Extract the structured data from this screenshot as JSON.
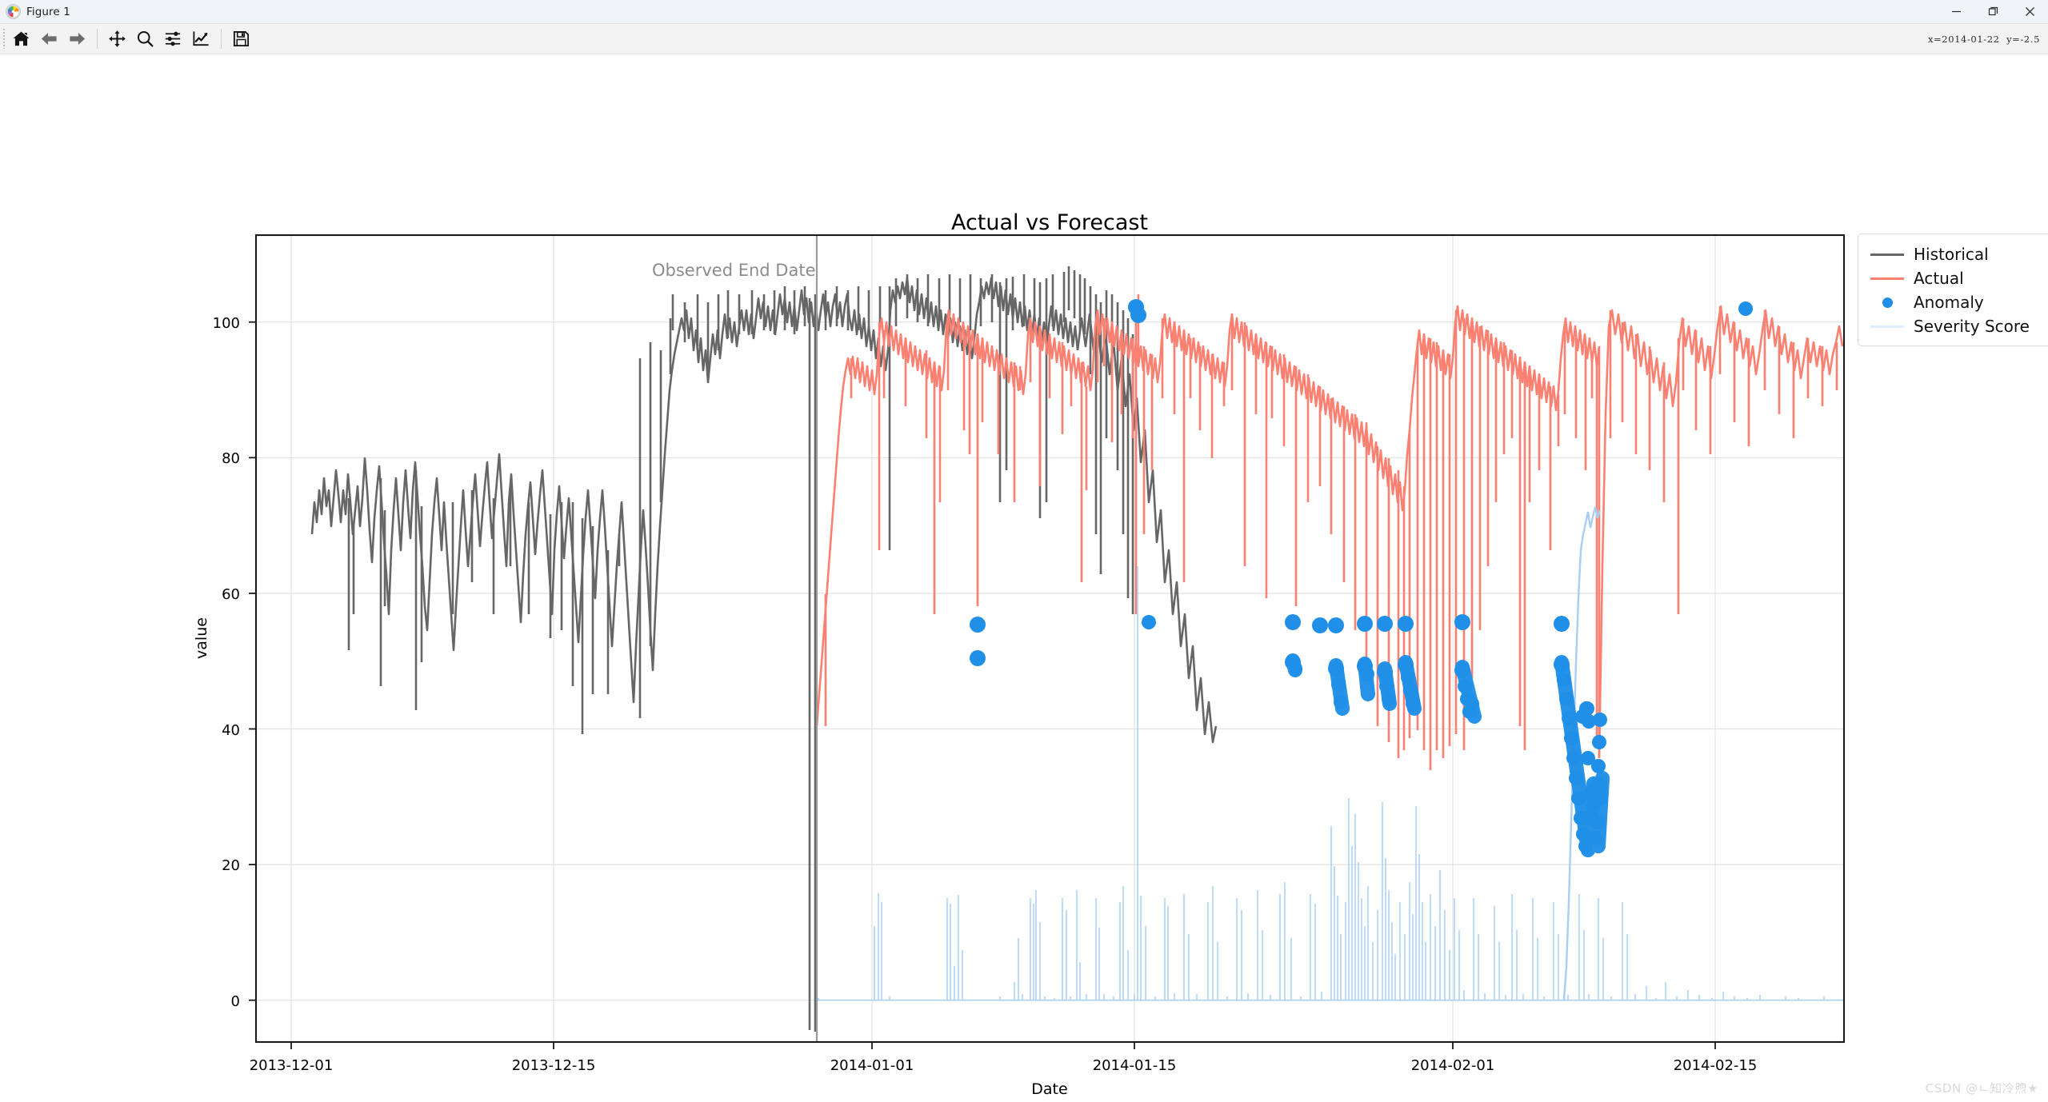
{
  "window": {
    "title": "Figure 1",
    "icon": "matplotlib-icon",
    "minimize_label": "—",
    "maximize_label": "□",
    "close_label": "✕"
  },
  "toolbar": {
    "buttons": [
      {
        "name": "home-icon",
        "tooltip": "Reset original view"
      },
      {
        "name": "back-arrow-icon",
        "tooltip": "Back to previous view"
      },
      {
        "name": "forward-arrow-icon",
        "tooltip": "Forward to next view"
      },
      {
        "name": "pan-move-icon",
        "tooltip": "Pan axes with left mouse, zoom with right"
      },
      {
        "name": "zoom-magnifier-icon",
        "tooltip": "Zoom to rectangle"
      },
      {
        "name": "subplot-config-sliders-icon",
        "tooltip": "Configure subplots"
      },
      {
        "name": "edit-curve-chart-icon",
        "tooltip": "Edit axis, curve and image parameters"
      },
      {
        "name": "save-floppy-icon",
        "tooltip": "Save the figure"
      }
    ],
    "coordinate_readout": "x=2014-01-22  y=-2.5"
  },
  "watermark": "CSDN @ㄴ知冷煦★",
  "legend": {
    "items": [
      {
        "label": "Historical",
        "marker": "line",
        "color": "#666666"
      },
      {
        "label": "Actual",
        "marker": "line",
        "color": "#fa8072"
      },
      {
        "label": "Anomaly",
        "marker": "dot",
        "color": "#1f8fe8"
      },
      {
        "label": "Severity Score",
        "marker": "line",
        "color": "#ddeeff"
      }
    ]
  },
  "annotations": [
    {
      "name": "observed-end-date-label",
      "text": "Observed End Date",
      "x": "2013-12-29",
      "color": "#8c8c8c"
    }
  ],
  "chart_data": {
    "type": "line",
    "title": "Actual vs Forecast",
    "xlabel": "Date",
    "ylabel": "value",
    "grid": true,
    "legend_position": "upper right outside",
    "xlim": [
      "2013-11-30",
      "2014-02-21"
    ],
    "ylim": [
      -6,
      113
    ],
    "yticks": [
      0,
      20,
      40,
      60,
      80,
      100
    ],
    "ytick_labels": [
      "0",
      "20",
      "40",
      "60",
      "80",
      "100"
    ],
    "xticks": [
      "2013-12-01",
      "2013-12-15",
      "2014-01-01",
      "2014-01-15",
      "2014-02-01",
      "2014-02-15"
    ],
    "xtick_labels": [
      "2013-12-01",
      "2013-12-15",
      "2014-01-01",
      "2014-01-15",
      "2014-02-01",
      "2014-02-15"
    ],
    "vline": {
      "label": "Observed End Date",
      "x": "2013-12-29",
      "color": "#9a9a9a"
    },
    "series": [
      {
        "name": "Historical",
        "color": "#666666",
        "type": "line",
        "x_range": [
          "2013-12-01",
          "2013-12-29"
        ],
        "y_range": [
          2.2,
          104.5
        ],
        "description": "Dense gray noisy signal oscillating mostly between 78 and 104 with sharp downward spikes to 48-68 and one extreme drop to ~2"
      },
      {
        "name": "Actual",
        "color": "#fa8072",
        "type": "line",
        "x_range": [
          "2013-12-29",
          "2014-02-20"
        ],
        "y_range": [
          46.0,
          105.0
        ],
        "description": "Dense salmon signal mostly 86-103 with frequent sharp dips to 58-75 and a deep cluster of drops to 46-58 around 2014-01-28 to 2014-02-09"
      },
      {
        "name": "Severity Score",
        "color": "#cce2fb",
        "type": "line",
        "x_range": [
          "2013-12-29",
          "2014-02-20"
        ],
        "y_range": [
          0.0,
          75.0
        ],
        "description": "Very light blue spiky score near 0 baseline with narrow spikes to 15-48 and a sustained rise to ~75 around 2014-02-09"
      },
      {
        "name": "Anomaly",
        "color": "#1f8fe8",
        "type": "scatter",
        "points": [
          {
            "x": "2014-01-05",
            "y": 57.5
          },
          {
            "x": "2014-01-05",
            "y": 52.5
          },
          {
            "x": "2014-01-15",
            "y": 105.0
          },
          {
            "x": "2014-01-15",
            "y": 104.0
          },
          {
            "x": "2014-01-16",
            "y": 57.8
          },
          {
            "x": "2014-01-22",
            "y": 57.8
          },
          {
            "x": "2014-01-22",
            "y": 52.0
          },
          {
            "x": "2014-01-22",
            "y": 51.3
          },
          {
            "x": "2014-01-27",
            "y": 57.6
          },
          {
            "x": "2014-01-27",
            "y": 51.5
          },
          {
            "x": "2014-01-28",
            "y": 57.6
          },
          {
            "x": "2014-01-28",
            "y": 49.6
          },
          {
            "x": "2014-01-29",
            "y": 57.6
          },
          {
            "x": "2014-01-29",
            "y": 52.0
          },
          {
            "x": "2014-01-29",
            "y": 46.5
          },
          {
            "x": "2014-02-01",
            "y": 57.8
          },
          {
            "x": "2014-02-01",
            "y": 50.6
          },
          {
            "x": "2014-02-01",
            "y": 44.0
          },
          {
            "x": "2014-02-06",
            "y": 57.5
          },
          {
            "x": "2014-02-06",
            "y": 51.5
          },
          {
            "x": "2014-02-07",
            "y": 38.0
          },
          {
            "x": "2014-02-07",
            "y": 31.5
          },
          {
            "x": "2014-02-07",
            "y": 26.0
          },
          {
            "x": "2014-02-08",
            "y": 35.5
          },
          {
            "x": "2014-02-08",
            "y": 31.0
          },
          {
            "x": "2014-02-08",
            "y": 44.0
          },
          {
            "x": "2014-02-14",
            "y": 104.0
          }
        ]
      }
    ]
  }
}
